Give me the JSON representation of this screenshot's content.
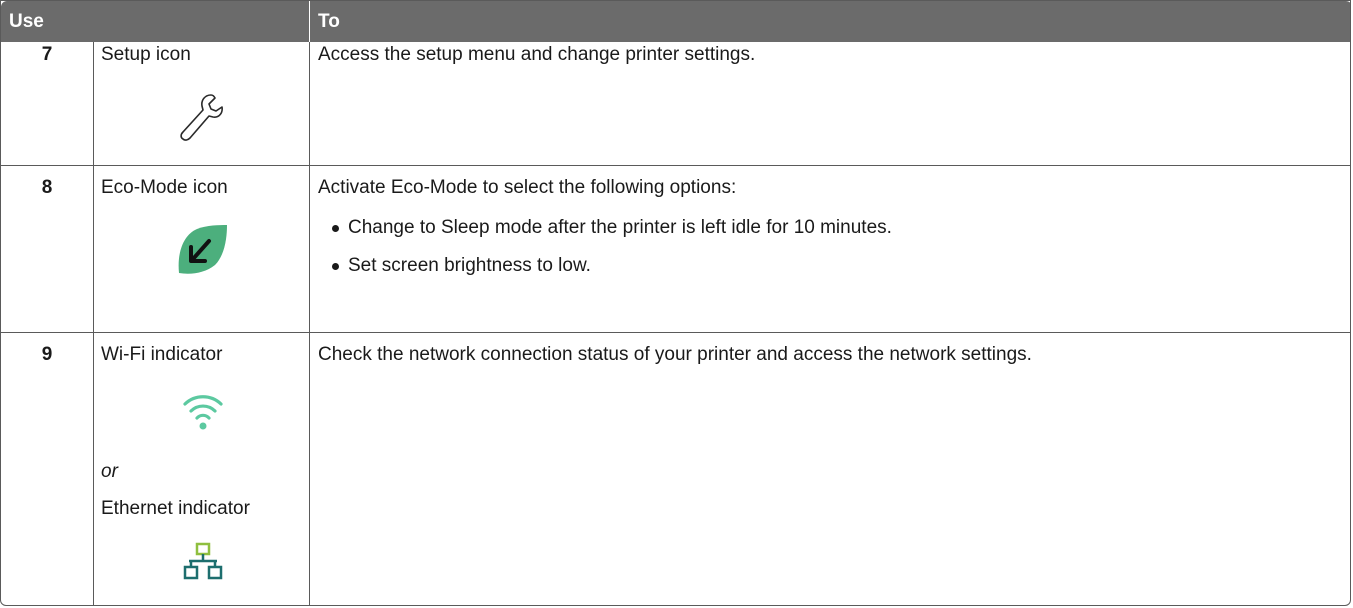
{
  "header": {
    "use_label": "Use",
    "to_label": "To"
  },
  "rows": [
    {
      "number": "7",
      "name": "Setup icon",
      "icon": "wrench-icon",
      "description": "Access the setup menu and change printer settings."
    },
    {
      "number": "8",
      "name": "Eco-Mode icon",
      "icon": "eco-leaf-icon",
      "description": "Activate Eco-Mode to select the following options:",
      "bullets": [
        "Change to Sleep mode after the printer is left idle for 10 minutes.",
        "Set screen brightness to low."
      ]
    },
    {
      "number": "9",
      "name": "Wi-Fi indicator",
      "icon": "wifi-icon",
      "or_text": "or",
      "alt_name": "Ethernet indicator",
      "alt_icon": "ethernet-icon",
      "description": "Check the network connection status of your printer and access the network settings."
    }
  ],
  "colors": {
    "header_bg": "#6b6b6b",
    "eco_green": "#4caf7d",
    "wifi_teal": "#5cc9a0",
    "ethernet_green": "#8fbf3f"
  }
}
